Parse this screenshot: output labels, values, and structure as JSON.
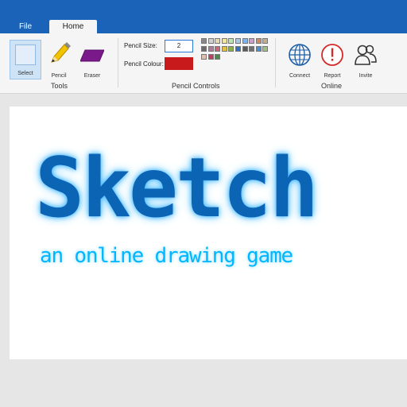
{
  "tabs": {
    "file": "File",
    "home": "Home"
  },
  "tools": {
    "select": "Select",
    "pencil": "Pencil",
    "eraser": "Eraser",
    "group": "Tools"
  },
  "pencil_controls": {
    "size_label": "Pencil Size:",
    "size_value": "2",
    "colour_label": "Pencil Colour:",
    "colour_value": "#c8191d",
    "group": "Pencil Controls",
    "palette": [
      "#888888",
      "#d0d0d0",
      "#e6d8b0",
      "#f0e6a0",
      "#bfe3b5",
      "#a9c7e6",
      "#7fb4e8",
      "#c9a0c9",
      "#d08a6a",
      "#c0ae90",
      "#6c6c6c",
      "#b07a9a",
      "#cc6677",
      "#e0c040",
      "#8ab04a",
      "#3070c0",
      "#5a5a5a",
      "#707070",
      "#4a90d0",
      "#a0c080",
      "#dcc0b0",
      "#c04060",
      "#4a8a4a"
    ]
  },
  "online": {
    "connect": "Connect",
    "report": "Report",
    "invite": "Invite",
    "group": "Online"
  },
  "canvas": {
    "title": "Sketch",
    "subtitle": "an online drawing game"
  }
}
